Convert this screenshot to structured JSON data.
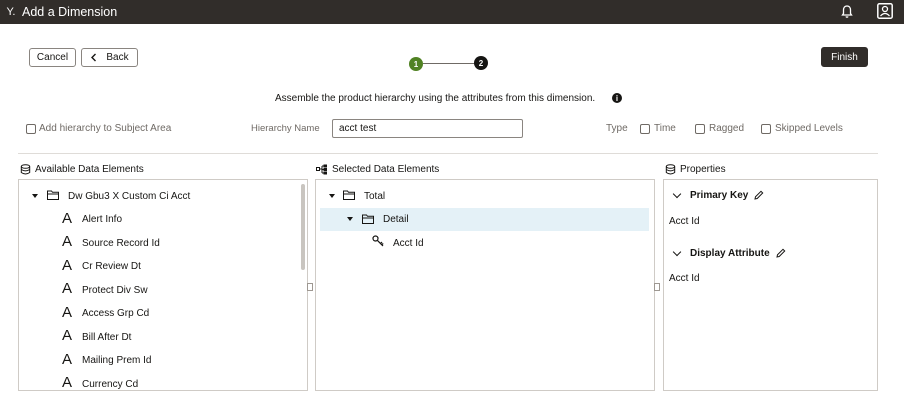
{
  "app": {
    "title": "Add a Dimension"
  },
  "toolbar": {
    "cancel_label": "Cancel",
    "back_label": "Back",
    "finish_label": "Finish"
  },
  "wizard": {
    "step1": "1",
    "step2": "2"
  },
  "instruction": "Assemble the product hierarchy using the attributes from this dimension.",
  "options": {
    "add_hierarchy_label": "Add hierarchy to Subject Area",
    "hierarchy_name_label": "Hierarchy Name",
    "hierarchy_name_value": "acct test",
    "type_label": "Type",
    "type_time": "Time",
    "type_ragged": "Ragged",
    "type_skipped": "Skipped Levels"
  },
  "available": {
    "title": "Available Data Elements",
    "root": "Dw Gbu3 X Custom Ci Acct",
    "items": [
      "Alert Info",
      "Source Record Id",
      "Cr Review Dt",
      "Protect Div Sw",
      "Access Grp Cd",
      "Bill After Dt",
      "Mailing Prem Id",
      "Currency Cd"
    ]
  },
  "selected": {
    "title": "Selected Data Elements",
    "level1": "Total",
    "level2": "Detail",
    "key": "Acct Id"
  },
  "properties": {
    "title": "Properties",
    "primary_key_label": "Primary Key",
    "primary_key_value": "Acct Id",
    "display_attr_label": "Display Attribute",
    "display_attr_value": "Acct Id"
  }
}
